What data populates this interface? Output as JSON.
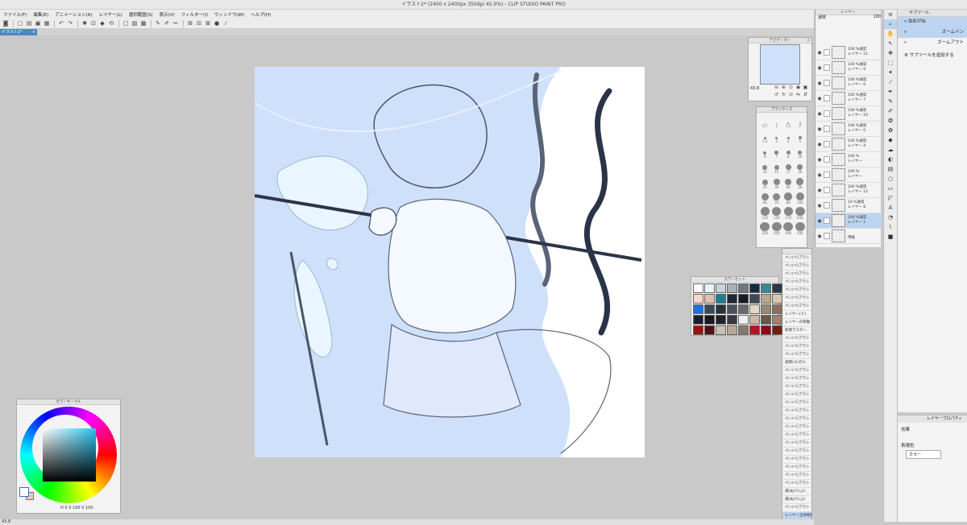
{
  "window": {
    "title": "イラスト2* (2400 x 2400px 350dpi 45.0%) - CLIP STUDIO PAINT PRO"
  },
  "menu": [
    "ファイル(F)",
    "編集(E)",
    "アニメーション(A)",
    "レイヤー(L)",
    "選択範囲(S)",
    "表示(V)",
    "フィルター(I)",
    "ウィンドウ(W)",
    "ヘルプ(H)"
  ],
  "document_tab": {
    "label": "イラスト2*",
    "close": "×"
  },
  "navigator": {
    "title": "ナビゲーター",
    "zoom": "43.8",
    "close": "×"
  },
  "brush_size": {
    "title": "ブラシサイズ",
    "sizes": [
      "0.7",
      "1",
      "1.5",
      "2",
      "2.5",
      "3",
      "4",
      "5",
      "6",
      "7",
      "8",
      "10",
      "12",
      "15",
      "17",
      "20",
      "25",
      "30",
      "40",
      "50",
      "60",
      "70",
      "80",
      "100",
      "120",
      "150",
      "170",
      "200",
      "250",
      "300",
      "400",
      "500"
    ]
  },
  "color_set": {
    "title": "カラーセット",
    "swatches": [
      "#ffffff",
      "#e8f4f8",
      "#c8d4dc",
      "#a8b0b8",
      "#707880",
      "#1a2a40",
      "#3a8898",
      "#2a3848",
      "#f8d8c8",
      "#e0c0b0",
      "#1a8090",
      "#202830",
      "#181c28",
      "#404858",
      "#b8a890",
      "#d8c8b0",
      "#2070e0",
      "#3a4858",
      "#283038",
      "#485060",
      "#686870",
      "#e0d8c8",
      "#988878",
      "#8a7060",
      "#182030",
      "#181820",
      "#202028",
      "#383840",
      "#f0f0f0",
      "#c8b8a8",
      "#685848",
      "#a08070",
      "#a01010",
      "#501018",
      "#c8c0b0",
      "#b8a898",
      "#887868",
      "#c01020",
      "#900818",
      "#702010"
    ]
  },
  "color_circle": {
    "title": "カラーサークル",
    "h": "0",
    "s": "100",
    "v": "100",
    "fg": "#ffffff",
    "bg": "#e8c8b8",
    "hue": "#27c4f0"
  },
  "subtool_list": {
    "items": [
      "ペン(ペ)ブラシ",
      "ペン(ペ)ブラシ",
      "ペン(ペ)ブラシ",
      "ペン(ペ)ブラシ",
      "ペン(ペ)ブラシ",
      "ペン(ペ)ブラシ",
      "ペン(ペ)ブラシ",
      "レイヤー(ド)",
      "レイヤーの移動",
      "新規ラスター",
      "ペン(ペ)ブラシ",
      "ペン(ペ)ブラシ",
      "ペン(ペ)ブラシ",
      "透明(カ)ゼル",
      "ペン(ペ)ブラシ",
      "ペン(ペ)ブラシ",
      "ペン(ペ)ブラシ",
      "ペン(ペ)ブラシ",
      "ペン(ペ)ブラシ",
      "ペン(ペ)ブラシ",
      "ペン(ペ)ブラシ",
      "ペン(ペ)ブラシ",
      "ペン(ペ)ブラシ",
      "ペン(ペ)ブラシ",
      "ペン(ペ)ブラシ",
      "ペン(ペ)ブラシ",
      "ペン(ペ)ブラシ",
      "ペン(ペ)ブラシ",
      "ペン(ペ)ブラシ",
      "選(ぬ)り(ぶ)",
      "選(ぬ)り(ぶ)",
      "ペン(ペ)ブラシ",
      "レイヤー全体移動"
    ],
    "selected": 32
  },
  "layers": {
    "title": "レイヤー",
    "blend": "通常",
    "opacity": "100",
    "rows": [
      {
        "pct": "100 %通常",
        "name": "レイヤー 11"
      },
      {
        "pct": "100 %通常",
        "name": "レイヤー 9"
      },
      {
        "pct": "100 %通常",
        "name": "レイヤー 6"
      },
      {
        "pct": "100 %通常",
        "name": "レイヤー 7"
      },
      {
        "pct": "100 %通常",
        "name": "レイヤー 10"
      },
      {
        "pct": "100 %通常",
        "name": "レイヤー 5"
      },
      {
        "pct": "100 %通常",
        "name": "レイヤー 4"
      },
      {
        "pct": "100 %",
        "name": "レイヤー"
      },
      {
        "pct": "100 %",
        "name": "レイヤー"
      },
      {
        "pct": "100 %通常",
        "name": "レイヤー 12"
      },
      {
        "pct": "10 %通常",
        "name": "レイヤー 8"
      },
      {
        "pct": "100 %通常",
        "name": "レイヤー 1"
      },
      {
        "pct": "",
        "name": "用紙"
      }
    ],
    "selected": 11
  },
  "tool_panel": {
    "header": "サブツール",
    "zoom_group": "虫めがね",
    "items": [
      "ズームイン",
      "ズームアウト"
    ],
    "add_subtool": "サブツールを追加する"
  },
  "layer_property": {
    "tab": "レイヤープロパティ",
    "effect": "効果",
    "display_color": "表現色",
    "color_mode": "カラー"
  },
  "status": {
    "zoom": "43.8"
  }
}
